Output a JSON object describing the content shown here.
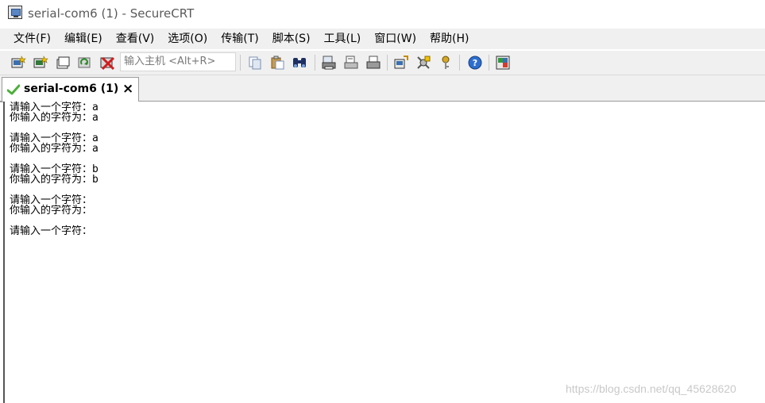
{
  "window": {
    "title": "serial-com6 (1) - SecureCRT"
  },
  "menubar": {
    "items": [
      {
        "label": "文件(F)"
      },
      {
        "label": "编辑(E)"
      },
      {
        "label": "查看(V)"
      },
      {
        "label": "选项(O)"
      },
      {
        "label": "传输(T)"
      },
      {
        "label": "脚本(S)"
      },
      {
        "label": "工具(L)"
      },
      {
        "label": "窗口(W)"
      },
      {
        "label": "帮助(H)"
      }
    ]
  },
  "toolbar": {
    "quick_connect_placeholder": "输入主机 <Alt+R>",
    "buttons": [
      "connect-icon",
      "quick-connect-icon",
      "connect-in-tab-icon",
      "reconnect-icon",
      "disconnect-icon",
      "copy-icon",
      "paste-icon",
      "find-icon",
      "print-screen-icon",
      "print-selection-icon",
      "print-icon",
      "session-options-icon",
      "global-options-icon",
      "keymap-icon",
      "help-icon",
      "sftp-icon"
    ]
  },
  "tabs": [
    {
      "label": "serial-com6 (1)",
      "close": "×",
      "status_color": "#4caf3a"
    }
  ],
  "terminal": {
    "lines": [
      "请输入一个字符：a",
      "你输入的字符为：a",
      "",
      "请输入一个字符：a",
      "你输入的字符为：a",
      "",
      "请输入一个字符：b",
      "你输入的字符为：b",
      "",
      "请输入一个字符：",
      "你输入的字符为：",
      "",
      "请输入一个字符："
    ]
  },
  "watermark": "https://blog.csdn.net/qq_45628620"
}
